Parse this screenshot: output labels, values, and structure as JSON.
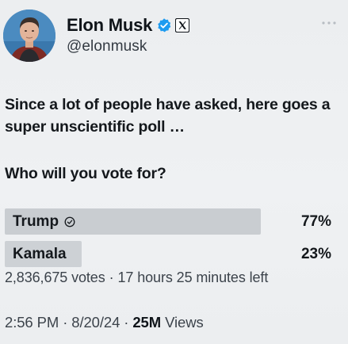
{
  "author": {
    "display_name": "Elon Musk",
    "handle": "@elonmusk",
    "verified_color": "#1d9bf0"
  },
  "icons": {
    "verified": "verified-badge-icon",
    "affiliation": "x-logo-icon",
    "more": "more-dots-icon",
    "winner_check": "check-circle-icon"
  },
  "tweet": {
    "text": "Since a lot of people have asked, here goes a super unscientific poll …",
    "question": "Who will you vote for?"
  },
  "poll": {
    "options": [
      {
        "label": "Trump",
        "percent_label": "77%",
        "fraction": 0.77,
        "winner": true
      },
      {
        "label": "Kamala",
        "percent_label": "23%",
        "fraction": 0.23,
        "winner": false
      }
    ],
    "votes": "2,836,675 votes",
    "time_left": "17 hours 25 minutes left"
  },
  "meta": {
    "time": "2:56 PM",
    "date": "8/20/24",
    "views_count": "25M",
    "views_label": "Views"
  }
}
